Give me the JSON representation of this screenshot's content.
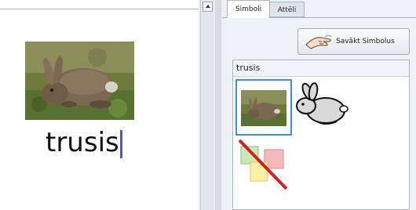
{
  "document": {
    "word": "trusis",
    "photo_icon": "rabbit-photo",
    "caret_color": "#4a5bd6"
  },
  "panel": {
    "tabs": [
      {
        "label": "Simboli",
        "active": true
      },
      {
        "label": "Attēli",
        "active": false
      }
    ],
    "remove_button": {
      "label": "Savākt Simbolus",
      "icon": "hand-icon"
    },
    "symbol_list": {
      "word": "trusis",
      "items": [
        {
          "icon": "rabbit-photo-thumbnail",
          "selected": true
        },
        {
          "icon": "rabbit-symbol",
          "selected": false
        },
        {
          "icon": "no-symbol-icon",
          "selected": false
        }
      ]
    },
    "selection_color": "#3d8fe0"
  }
}
